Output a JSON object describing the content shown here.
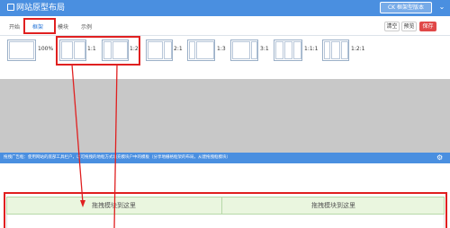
{
  "window": {
    "title": "网站原型布局",
    "top_button": "CK 框架型版本",
    "menu_chevron": "chevron-down-icon"
  },
  "tabs": [
    {
      "label": "开始"
    },
    {
      "label": "框架"
    },
    {
      "label": "模块"
    },
    {
      "label": "示例"
    }
  ],
  "actions": {
    "clear": "清空",
    "preview": "预览",
    "save": "保存"
  },
  "layouts": [
    {
      "label": "100%"
    },
    {
      "label": "1:1"
    },
    {
      "label": "1:2"
    },
    {
      "label": "2:1"
    },
    {
      "label": "1:3"
    },
    {
      "label": "3:1"
    },
    {
      "label": "1:1:1"
    },
    {
      "label": "1:2:1"
    }
  ],
  "infobar": {
    "text": "拖拽广告框：使用网站的底部工具栏户，以可拖拽的地框方式填充模块户中的模板（分享地栅格框架的布局，从建拖拽框模块）"
  },
  "dropzone": {
    "left": "拖拽模块到这里",
    "right": "拖拽模块到这里"
  },
  "colors": {
    "accent": "#4a8fe0",
    "highlight": "#e02020",
    "drop_bg": "#eaf6df"
  }
}
